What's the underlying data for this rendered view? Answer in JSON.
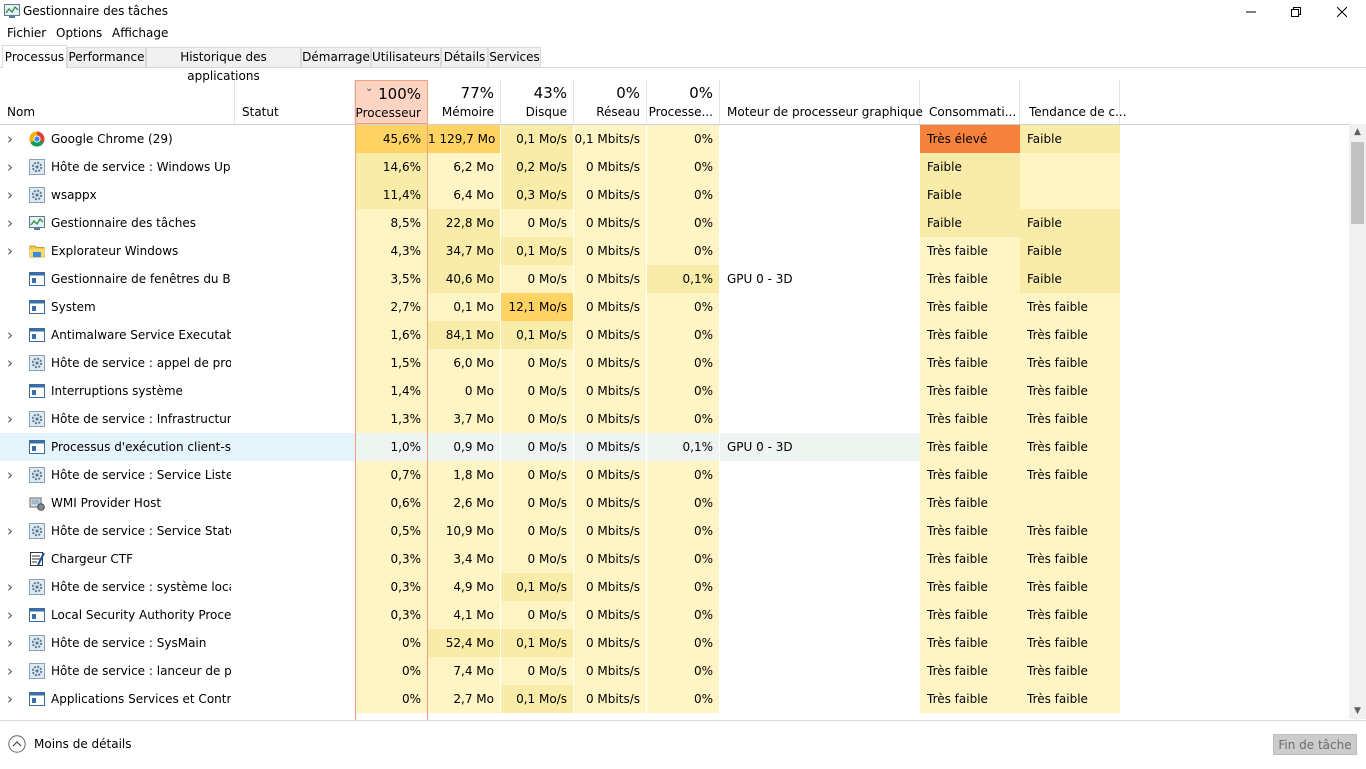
{
  "window": {
    "title": "Gestionnaire des tâches"
  },
  "menu": [
    "Fichier",
    "Options",
    "Affichage"
  ],
  "tabs": [
    "Processus",
    "Performance",
    "Historique des applications",
    "Démarrage",
    "Utilisateurs",
    "Détails",
    "Services"
  ],
  "active_tab": "Processus",
  "columns": {
    "name": "Nom",
    "status": "Statut",
    "cpu": {
      "pct": "100%",
      "label": "Processeur"
    },
    "mem": {
      "pct": "77%",
      "label": "Mémoire"
    },
    "disk": {
      "pct": "43%",
      "label": "Disque"
    },
    "net": {
      "pct": "0%",
      "label": "Réseau"
    },
    "gpu": {
      "pct": "0%",
      "label": "Processe..."
    },
    "gpu_engine": "Moteur de processeur graphique",
    "power": "Consommati...",
    "power_trend": "Tendance de c..."
  },
  "rows": [
    {
      "expand": true,
      "icon": "chrome",
      "name": "Google Chrome (29)",
      "cpu": "45,6%",
      "mem": "1 129,7 Mo",
      "disk": "0,1 Mo/s",
      "net": "0,1 Mbits/s",
      "gpu": "0%",
      "gpu_engine": "",
      "power": "Très élevé",
      "trend": "Faible"
    },
    {
      "expand": true,
      "icon": "gear",
      "name": "Hôte de service : Windows Upd...",
      "cpu": "14,6%",
      "mem": "6,2 Mo",
      "disk": "0,2 Mo/s",
      "net": "0 Mbits/s",
      "gpu": "0%",
      "gpu_engine": "",
      "power": "Faible",
      "trend": ""
    },
    {
      "expand": true,
      "icon": "gear",
      "name": "wsappx",
      "cpu": "11,4%",
      "mem": "6,4 Mo",
      "disk": "0,3 Mo/s",
      "net": "0 Mbits/s",
      "gpu": "0%",
      "gpu_engine": "",
      "power": "Faible",
      "trend": ""
    },
    {
      "expand": true,
      "icon": "taskmgr",
      "name": "Gestionnaire des tâches",
      "cpu": "8,5%",
      "mem": "22,8 Mo",
      "disk": "0 Mo/s",
      "net": "0 Mbits/s",
      "gpu": "0%",
      "gpu_engine": "",
      "power": "Faible",
      "trend": "Faible"
    },
    {
      "expand": true,
      "icon": "folder",
      "name": "Explorateur Windows",
      "cpu": "4,3%",
      "mem": "34,7 Mo",
      "disk": "0,1 Mo/s",
      "net": "0 Mbits/s",
      "gpu": "0%",
      "gpu_engine": "",
      "power": "Très faible",
      "trend": "Faible"
    },
    {
      "expand": false,
      "icon": "window",
      "name": "Gestionnaire de fenêtres du Bur...",
      "cpu": "3,5%",
      "mem": "40,6 Mo",
      "disk": "0 Mo/s",
      "net": "0 Mbits/s",
      "gpu": "0,1%",
      "gpu_engine": "GPU 0 - 3D",
      "power": "Très faible",
      "trend": "Faible"
    },
    {
      "expand": false,
      "icon": "window",
      "name": "System",
      "cpu": "2,7%",
      "mem": "0,1 Mo",
      "disk": "12,1 Mo/s",
      "net": "0 Mbits/s",
      "gpu": "0%",
      "gpu_engine": "",
      "power": "Très faible",
      "trend": "Très faible"
    },
    {
      "expand": true,
      "icon": "window",
      "name": "Antimalware Service Executable",
      "cpu": "1,6%",
      "mem": "84,1 Mo",
      "disk": "0,1 Mo/s",
      "net": "0 Mbits/s",
      "gpu": "0%",
      "gpu_engine": "",
      "power": "Très faible",
      "trend": "Très faible"
    },
    {
      "expand": true,
      "icon": "gear",
      "name": "Hôte de service : appel de procé...",
      "cpu": "1,5%",
      "mem": "6,0 Mo",
      "disk": "0 Mo/s",
      "net": "0 Mbits/s",
      "gpu": "0%",
      "gpu_engine": "",
      "power": "Très faible",
      "trend": "Très faible"
    },
    {
      "expand": false,
      "icon": "window",
      "name": "Interruptions système",
      "cpu": "1,4%",
      "mem": "0 Mo",
      "disk": "0 Mo/s",
      "net": "0 Mbits/s",
      "gpu": "0%",
      "gpu_engine": "",
      "power": "Très faible",
      "trend": "Très faible"
    },
    {
      "expand": true,
      "icon": "gear",
      "name": "Hôte de service : Infrastructure ...",
      "cpu": "1,3%",
      "mem": "3,7 Mo",
      "disk": "0 Mo/s",
      "net": "0 Mbits/s",
      "gpu": "0%",
      "gpu_engine": "",
      "power": "Très faible",
      "trend": "Très faible"
    },
    {
      "expand": false,
      "icon": "window",
      "name": "Processus d'exécution client-ser...",
      "cpu": "1,0%",
      "mem": "0,9 Mo",
      "disk": "0 Mo/s",
      "net": "0 Mbits/s",
      "gpu": "0,1%",
      "gpu_engine": "GPU 0 - 3D",
      "power": "Très faible",
      "trend": "Très faible",
      "highlight": true
    },
    {
      "expand": true,
      "icon": "gear",
      "name": "Hôte de service : Service Liste d...",
      "cpu": "0,7%",
      "mem": "1,8 Mo",
      "disk": "0 Mo/s",
      "net": "0 Mbits/s",
      "gpu": "0%",
      "gpu_engine": "",
      "power": "Très faible",
      "trend": "Très faible"
    },
    {
      "expand": false,
      "icon": "wmi",
      "name": "WMI Provider Host",
      "cpu": "0,6%",
      "mem": "2,6 Mo",
      "disk": "0 Mo/s",
      "net": "0 Mbits/s",
      "gpu": "0%",
      "gpu_engine": "",
      "power": "Très faible",
      "trend": ""
    },
    {
      "expand": true,
      "icon": "gear",
      "name": "Hôte de service : Service State R...",
      "cpu": "0,5%",
      "mem": "10,9 Mo",
      "disk": "0 Mo/s",
      "net": "0 Mbits/s",
      "gpu": "0%",
      "gpu_engine": "",
      "power": "Très faible",
      "trend": "Très faible"
    },
    {
      "expand": false,
      "icon": "ctf",
      "name": "Chargeur CTF",
      "cpu": "0,3%",
      "mem": "3,4 Mo",
      "disk": "0 Mo/s",
      "net": "0 Mbits/s",
      "gpu": "0%",
      "gpu_engine": "",
      "power": "Très faible",
      "trend": "Très faible"
    },
    {
      "expand": true,
      "icon": "gear",
      "name": "Hôte de service : système local",
      "cpu": "0,3%",
      "mem": "4,9 Mo",
      "disk": "0,1 Mo/s",
      "net": "0 Mbits/s",
      "gpu": "0%",
      "gpu_engine": "",
      "power": "Très faible",
      "trend": "Très faible"
    },
    {
      "expand": true,
      "icon": "window",
      "name": "Local Security Authority Process...",
      "cpu": "0,3%",
      "mem": "4,1 Mo",
      "disk": "0 Mo/s",
      "net": "0 Mbits/s",
      "gpu": "0%",
      "gpu_engine": "",
      "power": "Très faible",
      "trend": "Très faible"
    },
    {
      "expand": true,
      "icon": "gear",
      "name": "Hôte de service : SysMain",
      "cpu": "0%",
      "mem": "52,4 Mo",
      "disk": "0,1 Mo/s",
      "net": "0 Mbits/s",
      "gpu": "0%",
      "gpu_engine": "",
      "power": "Très faible",
      "trend": "Très faible"
    },
    {
      "expand": true,
      "icon": "gear",
      "name": "Hôte de service : lanceur de pro...",
      "cpu": "0%",
      "mem": "7,4 Mo",
      "disk": "0 Mo/s",
      "net": "0 Mbits/s",
      "gpu": "0%",
      "gpu_engine": "",
      "power": "Très faible",
      "trend": "Très faible"
    },
    {
      "expand": true,
      "icon": "window",
      "name": "Applications Services et Contrôl...",
      "cpu": "0%",
      "mem": "2,7 Mo",
      "disk": "0,1 Mo/s",
      "net": "0 Mbits/s",
      "gpu": "0%",
      "gpu_engine": "",
      "power": "Très faible",
      "trend": "Très faible"
    }
  ],
  "footer": {
    "less_details": "Moins de détails",
    "end_task": "Fin de tâche"
  },
  "colors": {
    "cpu_header_bg": "#fdd3c4",
    "cpu_header_border": "#f0a37f",
    "heat_light": "#fff4c4",
    "heat_mid": "#f9eca8",
    "heat_strong": "#ffd264",
    "power_very_high": "#f7823d",
    "row_highlight": "#e5f3fb"
  }
}
